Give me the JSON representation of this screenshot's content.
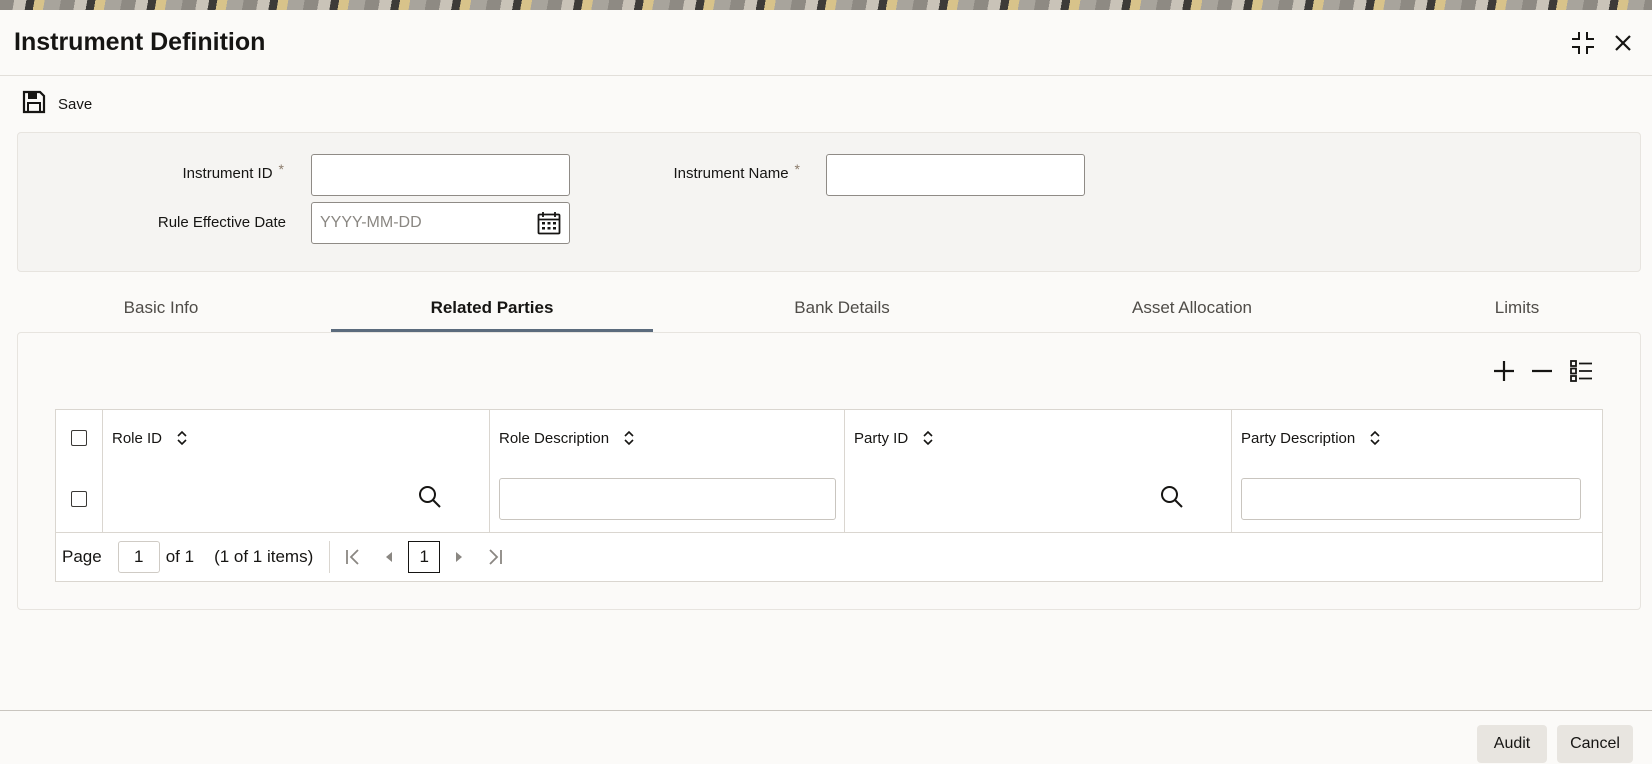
{
  "window": {
    "title": "Instrument Definition"
  },
  "toolbar": {
    "save_label": "Save"
  },
  "form": {
    "instrument_id": {
      "label": "Instrument ID",
      "required": "*",
      "value": ""
    },
    "instrument_name": {
      "label": "Instrument Name",
      "required": "*",
      "value": ""
    },
    "rule_effective_date": {
      "label": "Rule Effective Date",
      "placeholder": "YYYY-MM-DD",
      "value": ""
    }
  },
  "tabs": [
    {
      "label": "Basic Info",
      "active": false
    },
    {
      "label": "Related Parties",
      "active": true
    },
    {
      "label": "Bank Details",
      "active": false
    },
    {
      "label": "Asset Allocation",
      "active": false
    },
    {
      "label": "Limits",
      "active": false
    }
  ],
  "grid": {
    "columns": [
      "Role ID",
      "Role Description",
      "Party ID",
      "Party Description"
    ],
    "rows": [
      {
        "role_id": "",
        "role_description": "",
        "party_id": "",
        "party_description": ""
      }
    ]
  },
  "pager": {
    "page_label": "Page",
    "current_page": "1",
    "of_label": "of 1",
    "items_label": "(1 of 1 items)",
    "page_button": "1"
  },
  "footer": {
    "audit_label": "Audit",
    "cancel_label": "Cancel"
  },
  "colors": {
    "accent_tab_underline": "#5b6b7d",
    "text": "#161513",
    "panel": "#f5f4f2"
  },
  "icons": [
    "save-icon",
    "compress-icon",
    "close-icon",
    "calendar-icon",
    "add-icon",
    "remove-icon",
    "column-list-icon",
    "sort-icon",
    "search-icon",
    "first-page-icon",
    "previous-page-icon",
    "next-page-icon",
    "last-page-icon"
  ]
}
